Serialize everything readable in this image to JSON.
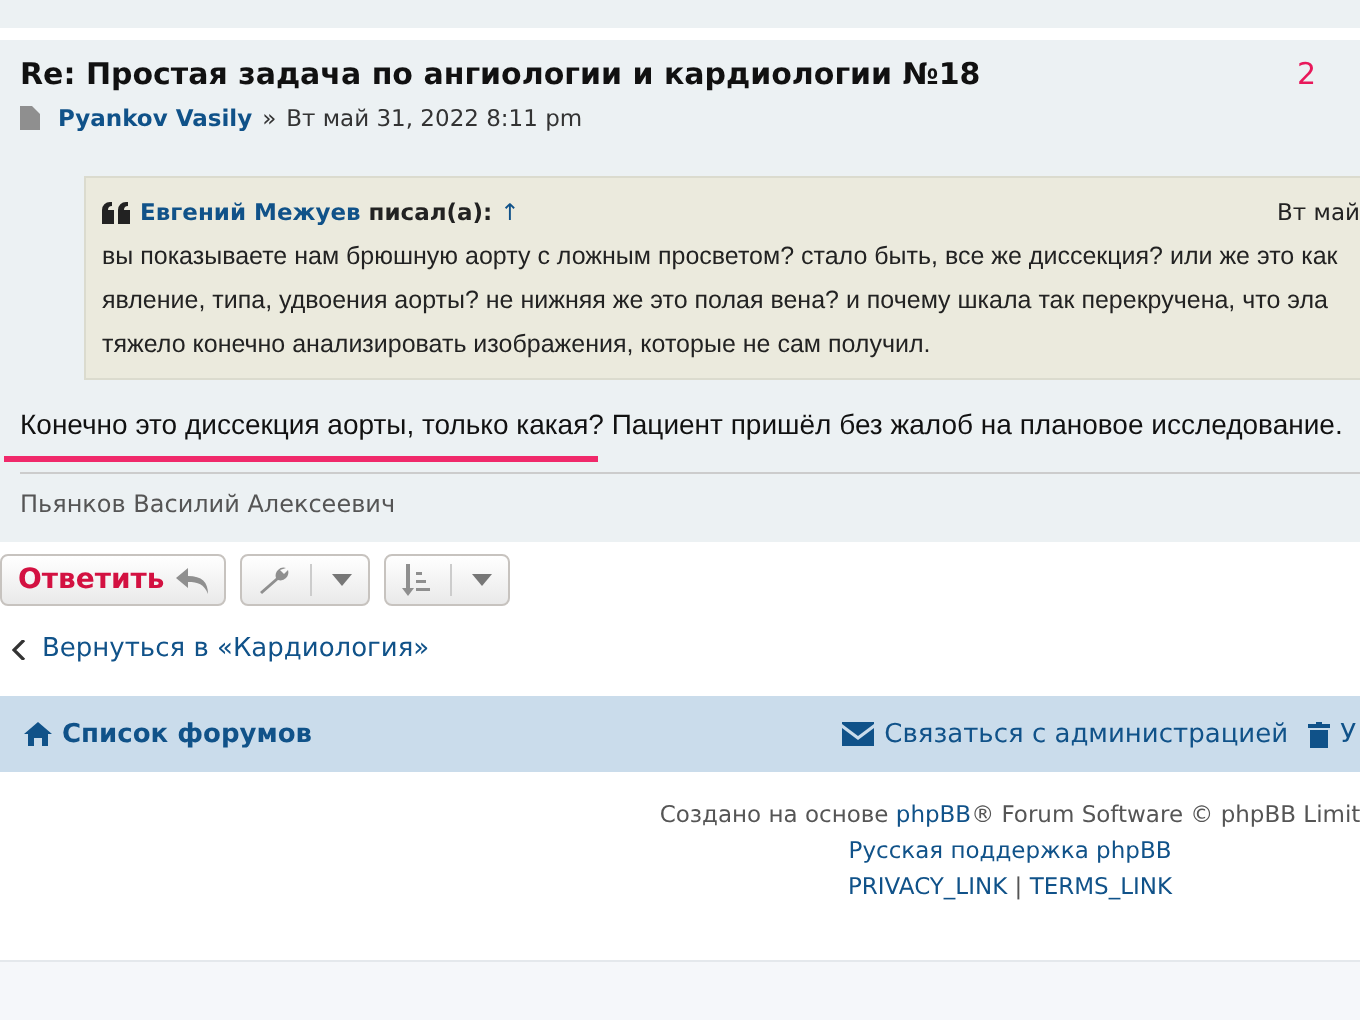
{
  "post": {
    "title": "Re: Простая задача по ангиологии и кардиологии №18",
    "author": "Pyankov Vasily",
    "separator": "»",
    "date": "Вт май 31, 2022 8:11 pm",
    "number": "2",
    "quote": {
      "author": "Евгений Межуев",
      "says": "писал(а):",
      "up": "↑",
      "date": "Вт май",
      "lines": [
        "вы показываете нам брюшную аорту с ложным просветом? стало быть, все же диссекция? или же это как",
        "явление, типа, удвоения аорты? не нижняя же это полая вена? и почему шкала так перекручена, что эла",
        "тяжело конечно анализировать изображения, которые не сам получил."
      ]
    },
    "message": "Конечно это диссекция аорты, только какая? Пациент пришёл без жалоб на плановое исследование.",
    "signature": "Пьянков Василий Алексеевич"
  },
  "actions": {
    "reply": "Ответить"
  },
  "back_link": "Вернуться в «Кардиология»",
  "navbar": {
    "home": "Список форумов",
    "contact": "Связаться с администрацией",
    "delete": "У"
  },
  "footer": {
    "prefix": "Создано на основе",
    "phpbb": "phpBB",
    "suffix": "® Forum Software © phpBB Limit",
    "support": "Русская поддержка phpBB",
    "privacy": "PRIVACY_LINK",
    "sep": "|",
    "terms": "TERMS_LINK"
  }
}
